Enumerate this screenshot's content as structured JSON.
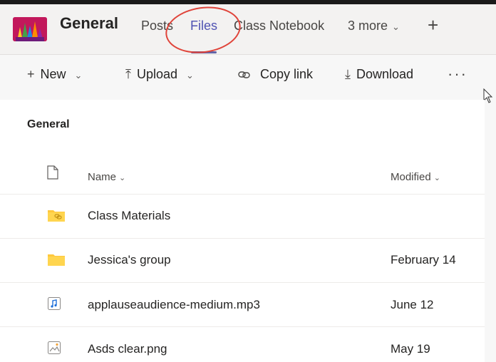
{
  "header": {
    "channel_name": "General",
    "tabs": [
      {
        "label": "Posts"
      },
      {
        "label": "Files"
      },
      {
        "label": "Class Notebook"
      }
    ],
    "more_label": "3 more",
    "add_tab_glyph": "+"
  },
  "toolbar": {
    "new_label": "New",
    "upload_label": "Upload",
    "copy_link_label": "Copy link",
    "download_label": "Download",
    "overflow_glyph": "···"
  },
  "section": {
    "title": "General"
  },
  "table": {
    "columns": {
      "name": "Name",
      "modified": "Modified"
    },
    "rows": [
      {
        "name": "Class Materials",
        "modified": "",
        "icon": "linked-folder-icon"
      },
      {
        "name": "Jessica's group",
        "modified": "February 14",
        "icon": "folder-icon"
      },
      {
        "name": "applauseaudience-medium.mp3",
        "modified": "June 12",
        "icon": "audio-file-icon"
      },
      {
        "name": "Asds clear.png",
        "modified": "May 19",
        "icon": "image-file-icon"
      }
    ]
  },
  "colors": {
    "accent": "#6264a7",
    "annotation": "#e0443a",
    "folder": "#ffd54f"
  }
}
